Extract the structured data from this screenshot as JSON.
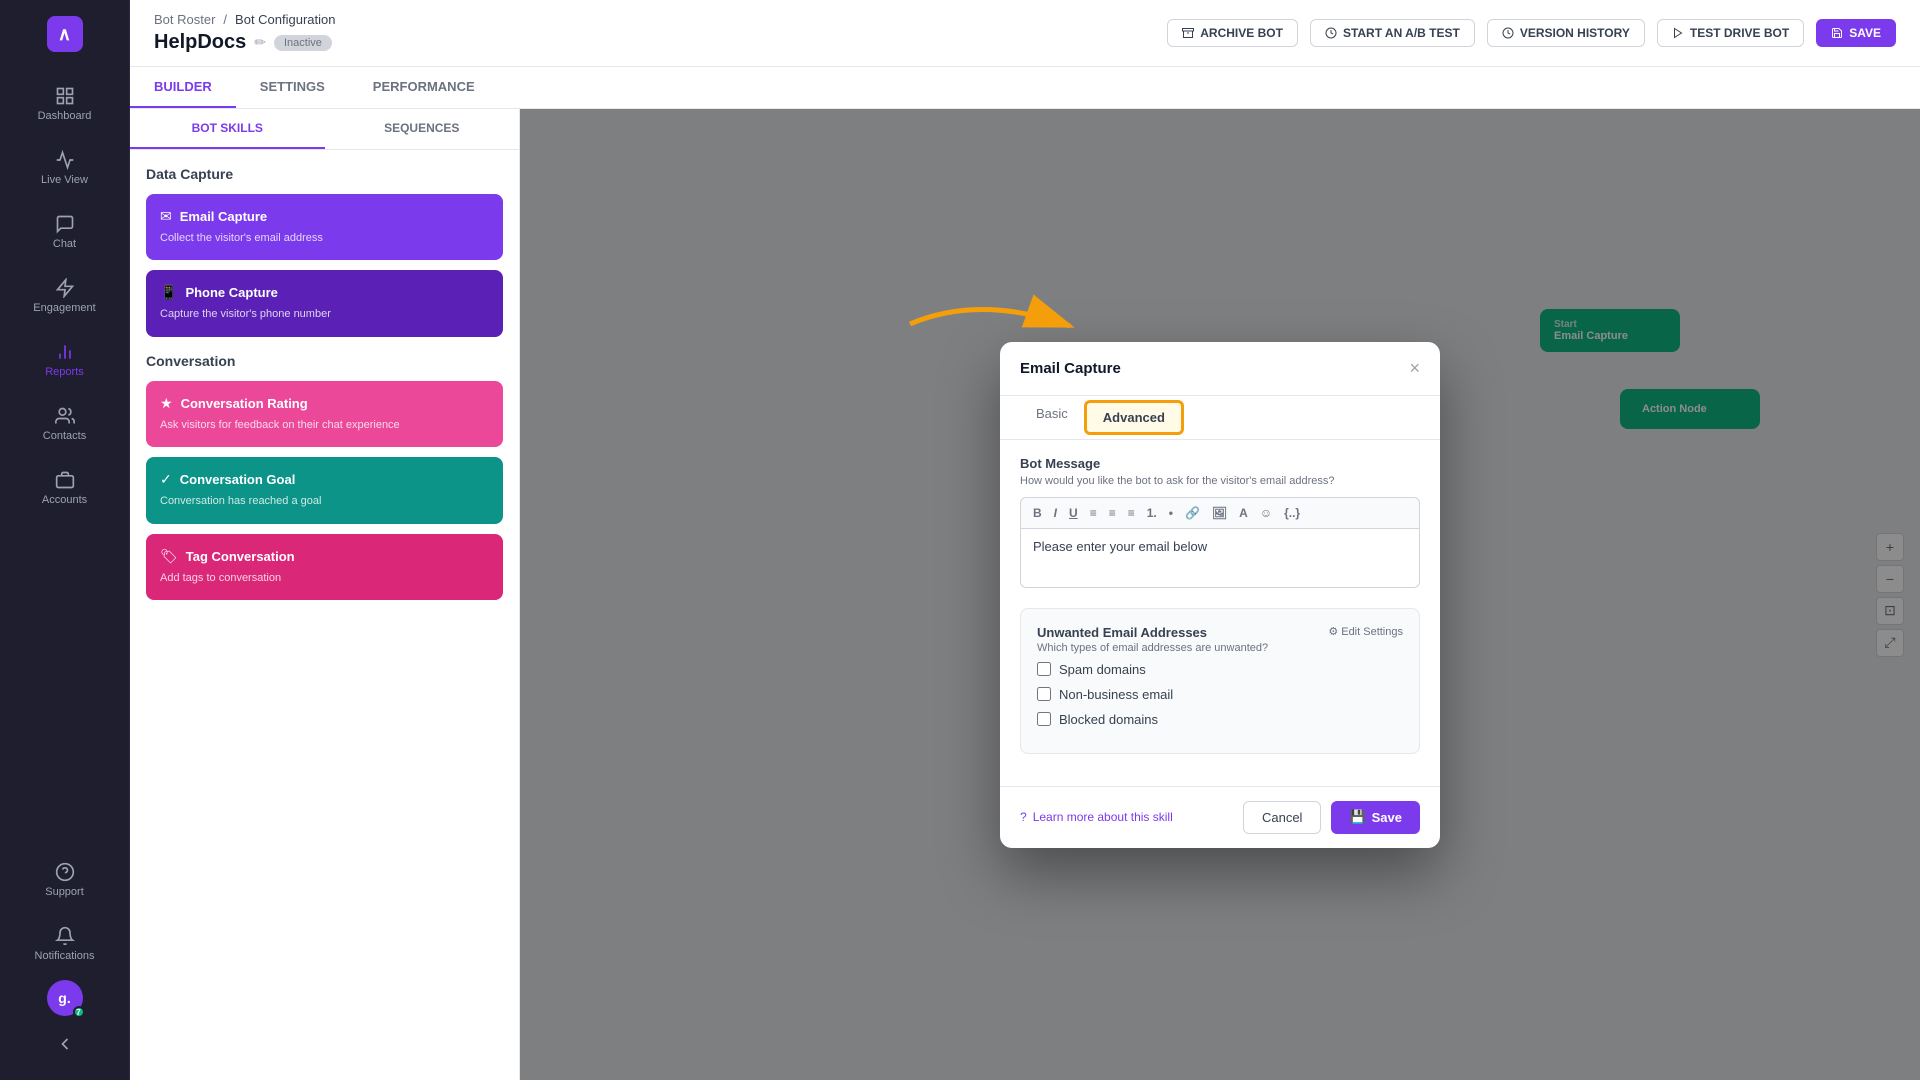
{
  "sidebar": {
    "logo": "∧",
    "items": [
      {
        "id": "dashboard",
        "label": "Dashboard",
        "icon": "grid"
      },
      {
        "id": "live-view",
        "label": "Live View",
        "icon": "activity"
      },
      {
        "id": "chat",
        "label": "Chat",
        "icon": "message"
      },
      {
        "id": "engagement",
        "label": "Engagement",
        "icon": "zap"
      },
      {
        "id": "reports",
        "label": "Reports",
        "icon": "bar-chart",
        "active": true
      },
      {
        "id": "contacts",
        "label": "Contacts",
        "icon": "users"
      },
      {
        "id": "accounts",
        "label": "Accounts",
        "icon": "briefcase"
      }
    ],
    "bottom": [
      {
        "id": "support",
        "label": "Support",
        "icon": "help-circle"
      },
      {
        "id": "notifications",
        "label": "Notifications",
        "icon": "bell"
      }
    ],
    "user": {
      "initials": "g.",
      "badge": "7"
    }
  },
  "topbar": {
    "breadcrumb": {
      "parent": "Bot Roster",
      "separator": "/",
      "current": "Bot Configuration"
    },
    "page_title": "HelpDocs",
    "status": "Inactive",
    "actions": [
      {
        "id": "archive",
        "label": "ARCHIVE BOT",
        "icon": "archive"
      },
      {
        "id": "ab-test",
        "label": "START AN A/B TEST",
        "icon": "test"
      },
      {
        "id": "version-history",
        "label": "VERSION HISTORY",
        "icon": "clock"
      },
      {
        "id": "test-drive",
        "label": "TEST DRIVE BOT",
        "icon": "play"
      },
      {
        "id": "save",
        "label": "SAVE",
        "icon": "save",
        "primary": true
      }
    ]
  },
  "tabs": [
    {
      "id": "builder",
      "label": "BUILDER",
      "active": true
    },
    {
      "id": "settings",
      "label": "SETTINGS"
    },
    {
      "id": "performance",
      "label": "PERFORMANCE"
    }
  ],
  "left_panel": {
    "tabs": [
      {
        "id": "bot-skills",
        "label": "BOT SKILLS",
        "active": true
      },
      {
        "id": "sequences",
        "label": "SEQUENCES"
      }
    ],
    "sections": {
      "data_capture": {
        "title": "Data Capture",
        "cards": [
          {
            "id": "email-capture",
            "title": "Email Capture",
            "desc": "Collect the visitor's email address",
            "color": "purple",
            "icon": "✉"
          },
          {
            "id": "phone-capture",
            "title": "Phone Capture",
            "desc": "Capture the visitor's phone number",
            "color": "purple-outline",
            "icon": "📱"
          }
        ]
      },
      "conversation": {
        "title": "Conversation",
        "cards": [
          {
            "id": "conversation-rating",
            "title": "Conversation Rating",
            "desc": "Ask visitors for feedback on their chat experience",
            "color": "pink",
            "icon": "★"
          },
          {
            "id": "conversation-goal",
            "title": "Conversation Goal",
            "desc": "Conversation has reached a goal",
            "color": "teal",
            "icon": "✓"
          },
          {
            "id": "tag-conversation",
            "title": "Tag Conversation",
            "desc": "Add tags to conversation",
            "color": "pink2",
            "icon": "🏷"
          }
        ]
      }
    }
  },
  "modal": {
    "title": "Email Capture",
    "close_label": "×",
    "tabs": [
      {
        "id": "basic",
        "label": "Basic"
      },
      {
        "id": "advanced",
        "label": "Advanced",
        "highlighted": true
      }
    ],
    "bot_message": {
      "section_title": "Bot Message",
      "section_desc": "How would you like the bot to ask for the visitor's email address?",
      "editor_content": "Please enter your email below",
      "toolbar_buttons": [
        "B",
        "I",
        "U",
        "≡",
        "≡",
        "≡",
        "1.",
        "•",
        "🔗",
        "🖼",
        "A",
        "☺",
        "{..}"
      ]
    },
    "unwanted_emails": {
      "section_title": "Unwanted Email Addresses",
      "section_desc": "Which types of email addresses are unwanted?",
      "edit_settings_label": "⚙ Edit Settings",
      "options": [
        {
          "id": "spam",
          "label": "Spam domains",
          "checked": false
        },
        {
          "id": "non-business",
          "label": "Non-business email",
          "checked": false
        },
        {
          "id": "blocked",
          "label": "Blocked domains",
          "checked": false
        }
      ]
    },
    "footer": {
      "learn_more": "Learn more about this skill",
      "cancel_label": "Cancel",
      "save_label": "Save",
      "save_icon": "💾"
    }
  },
  "annotation": {
    "arrow_color": "#f59e0b",
    "highlight_color": "#f59e0b"
  }
}
